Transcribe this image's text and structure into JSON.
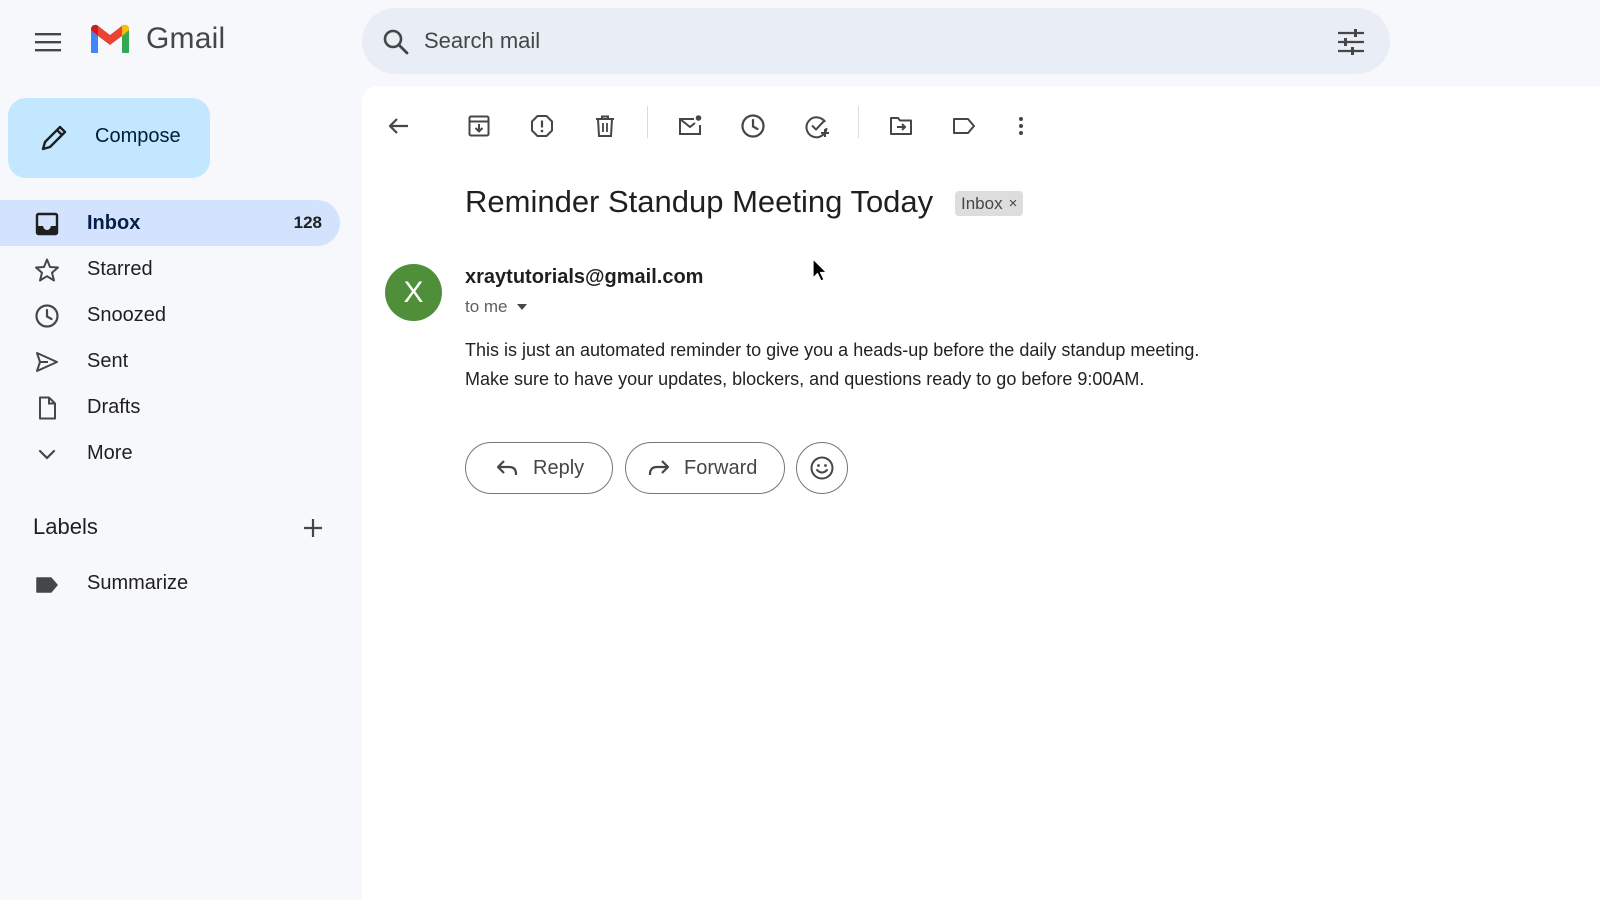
{
  "header": {
    "app_name": "Gmail",
    "search_placeholder": "Search mail"
  },
  "sidebar": {
    "compose_label": "Compose",
    "items": [
      {
        "label": "Inbox",
        "count": "128",
        "icon": "inbox-icon",
        "active": true
      },
      {
        "label": "Starred",
        "icon": "star-icon"
      },
      {
        "label": "Snoozed",
        "icon": "clock-icon"
      },
      {
        "label": "Sent",
        "icon": "send-icon"
      },
      {
        "label": "Drafts",
        "icon": "draft-icon"
      },
      {
        "label": "More",
        "icon": "chevron-down-icon"
      }
    ],
    "labels_heading": "Labels",
    "labels": [
      {
        "label": "Summarize",
        "icon": "label-icon"
      }
    ]
  },
  "toolbar": {
    "icons": [
      "back-arrow-icon",
      "archive-icon",
      "report-spam-icon",
      "delete-icon",
      "mark-unread-icon",
      "snooze-icon",
      "add-task-icon",
      "move-to-icon",
      "label-as-icon",
      "more-vert-icon"
    ]
  },
  "email": {
    "subject": "Reminder Standup Meeting Today",
    "chip_label": "Inbox",
    "chip_close": "×",
    "avatar_letter": "X",
    "sender": "xraytutorials@gmail.com",
    "recipient": "to me",
    "body_line1": "This is just an automated reminder to give you a heads-up before the daily standup meeting.",
    "body_line2": "Make sure to have your updates, blockers, and questions ready to go before 9:00AM.",
    "reply_label": "Reply",
    "forward_label": "Forward"
  },
  "colors": {
    "background": "#f6f8fc",
    "compose": "#c2e7ff",
    "active_nav": "#d3e3fd",
    "search": "#e9eef6",
    "avatar": "#4f8f3a"
  }
}
